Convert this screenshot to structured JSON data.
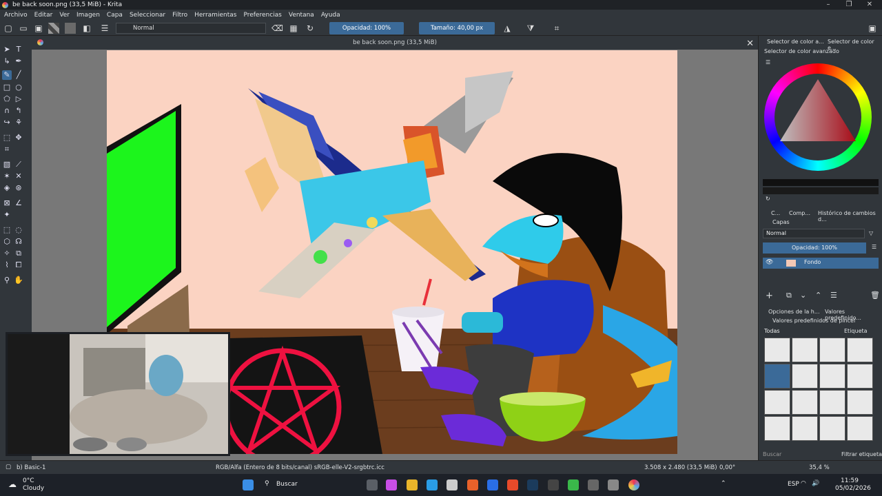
{
  "window": {
    "title": "be back soon.png (33,5 MiB) - Krita"
  },
  "menu": [
    "Archivo",
    "Editar",
    "Ver",
    "Imagen",
    "Capa",
    "Seleccionar",
    "Filtro",
    "Herramientas",
    "Preferencias",
    "Ventana",
    "Ayuda"
  ],
  "toolbar": {
    "blend_mode": "Normal",
    "opacity": "Opacidad: 100%",
    "size": "Tamaño: 40,00 px"
  },
  "document": {
    "tab_title": "be back soon.png (33,5 MiB)"
  },
  "right_panel": {
    "tabs": [
      "Selector de color a...",
      "Selector de color e..."
    ],
    "color_selector_title": "Selector de color avanzado",
    "sub_tabs": [
      "C...",
      "Comp...",
      "Histórico de cambios d..."
    ],
    "layers": {
      "title": "Capas",
      "blend_mode": "Normal",
      "opacity": "Opacidad: 100%",
      "layer_name": "Fondo"
    },
    "bottom_tabs": [
      "Opciones de la h...",
      "Valores predefinido..."
    ],
    "presets": {
      "title": "Valores predefinidos de pincel",
      "filter": "Todas",
      "tag_label": "Etiqueta",
      "search_placeholder": "Buscar",
      "filter_tag": "Filtrar etiqueta"
    }
  },
  "status": {
    "brush": "b) Basic-1",
    "color_space": "RGB/Alfa (Entero de 8 bits/canal)  sRGB-elle-V2-srgbtrc.icc",
    "dimensions": "3.508 x 2.480 (33,5 MiB)",
    "rotation": "0,00°",
    "zoom": "35,4 %"
  },
  "taskbar": {
    "weather_temp": "0°C",
    "weather_desc": "Cloudy",
    "search": "Buscar",
    "lang": "ESP",
    "time": "11:59",
    "date": "05/02/2026"
  }
}
